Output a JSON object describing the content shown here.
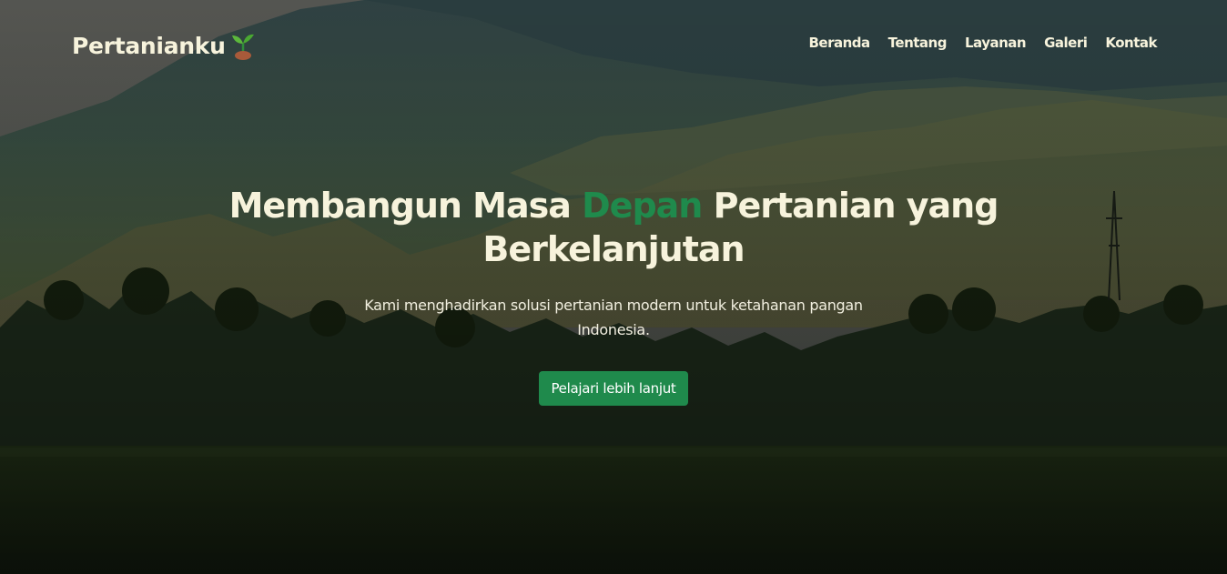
{
  "brand": {
    "name": "Pertanianku",
    "icon": "seedling-icon"
  },
  "nav": {
    "items": [
      {
        "label": "Beranda"
      },
      {
        "label": "Tentang"
      },
      {
        "label": "Layanan"
      },
      {
        "label": "Galeri"
      },
      {
        "label": "Kontak"
      }
    ]
  },
  "hero": {
    "headline_before": "Membangun Masa",
    "headline_accent": "Depan",
    "headline_after": "Pertanian yang Berkelanjutan",
    "subtitle": "Kami menghadirkan solusi pertanian modern untuk ketahanan pangan Indonesia.",
    "cta_label": "Pelajari lebih lanjut"
  },
  "colors": {
    "accent": "#1f8a4c",
    "text_light": "#f7f3dc"
  }
}
